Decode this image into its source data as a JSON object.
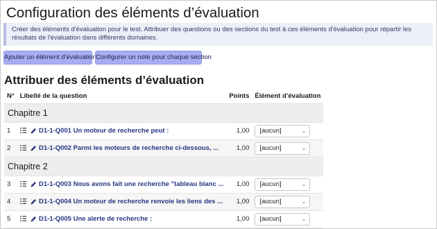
{
  "page": {
    "title": "Configuration des éléments d’évaluation",
    "info": "Créer des éléments d'évaluation pour le test. Attribuer des questions ou des sections du test à ces éléments d'évaluation pour répartir les résultats de l'évaluation dans différents domaines."
  },
  "buttons": {
    "add": "Ajouter un élément d'évaluation",
    "config": "Configurer un note pour chaque section"
  },
  "section": {
    "title": "Attribuer des éléments d’évaluation"
  },
  "table": {
    "headers": {
      "num": "N°",
      "label": "Libellé de la question",
      "points": "Points",
      "eval": "Élément d’évaluation"
    },
    "chapters": [
      {
        "name": "Chapitre 1",
        "rows": [
          {
            "num": "1",
            "label": "D1-1-Q001 Un moteur de recherche peut :",
            "points": "1,00",
            "eval": "[aucun]"
          },
          {
            "num": "2",
            "label": "D1-1-Q002 Parmi les moteurs de recherche ci-dessous, ...",
            "points": "1,00",
            "eval": "[aucun]"
          }
        ]
      },
      {
        "name": "Chapitre 2",
        "rows": [
          {
            "num": "3",
            "label": "D1-1-Q003 Nous avons fait une recherche \"tableau blanc ...",
            "points": "1,00",
            "eval": "[aucun]"
          },
          {
            "num": "4",
            "label": "D1-1-Q004 Un moteur de recherche renvoie les liens des ...",
            "points": "1,00",
            "eval": "[aucun]"
          },
          {
            "num": "5",
            "label": "D1-1-Q005 Une alerte de recherche :",
            "points": "1,00",
            "eval": "[aucun]"
          }
        ]
      }
    ]
  },
  "icons": {
    "drag": "drag-handle-icon",
    "edit": "pencil-icon",
    "select_arrow": "chevron-down-icon"
  },
  "colors": {
    "button_bg": "#a6aef0",
    "info_bg": "#eceef8",
    "link": "#273582",
    "chapter_bg": "#eeeeee"
  }
}
